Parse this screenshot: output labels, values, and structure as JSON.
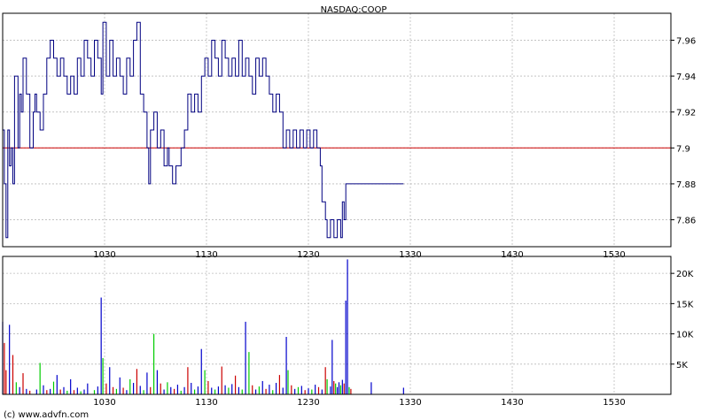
{
  "chart_data": [
    {
      "type": "line",
      "title": "NASDAQ:COOP",
      "xlabel": "",
      "ylabel": "",
      "x_ticks": [
        "1030",
        "1130",
        "1230",
        "1330",
        "1430",
        "1530"
      ],
      "y_ticks": [
        "7.86",
        "7.88",
        "7.9",
        "7.92",
        "7.94",
        "7.96"
      ],
      "ylim": [
        7.845,
        7.975
      ],
      "xlim_minutes": [
        570,
        960
      ],
      "reference_line": {
        "value": 7.9,
        "color": "#cc0000"
      },
      "series": [
        {
          "color": "#000080",
          "points": [
            [
              570,
              7.91
            ],
            [
              571,
              7.88
            ],
            [
              572,
              7.85
            ],
            [
              573,
              7.91
            ],
            [
              574,
              7.89
            ],
            [
              575,
              7.9
            ],
            [
              576,
              7.88
            ],
            [
              577,
              7.94
            ],
            [
              579,
              7.9
            ],
            [
              580,
              7.93
            ],
            [
              581,
              7.92
            ],
            [
              582,
              7.95
            ],
            [
              584,
              7.93
            ],
            [
              586,
              7.9
            ],
            [
              588,
              7.92
            ],
            [
              589,
              7.93
            ],
            [
              590,
              7.92
            ],
            [
              592,
              7.91
            ],
            [
              594,
              7.93
            ],
            [
              596,
              7.95
            ],
            [
              598,
              7.96
            ],
            [
              600,
              7.95
            ],
            [
              602,
              7.94
            ],
            [
              604,
              7.95
            ],
            [
              606,
              7.94
            ],
            [
              608,
              7.93
            ],
            [
              610,
              7.94
            ],
            [
              612,
              7.93
            ],
            [
              614,
              7.95
            ],
            [
              616,
              7.94
            ],
            [
              618,
              7.96
            ],
            [
              620,
              7.95
            ],
            [
              622,
              7.94
            ],
            [
              624,
              7.96
            ],
            [
              626,
              7.95
            ],
            [
              628,
              7.93
            ],
            [
              629,
              7.97
            ],
            [
              631,
              7.94
            ],
            [
              633,
              7.96
            ],
            [
              635,
              7.94
            ],
            [
              637,
              7.95
            ],
            [
              639,
              7.94
            ],
            [
              641,
              7.93
            ],
            [
              643,
              7.95
            ],
            [
              645,
              7.94
            ],
            [
              647,
              7.96
            ],
            [
              649,
              7.97
            ],
            [
              651,
              7.93
            ],
            [
              653,
              7.92
            ],
            [
              655,
              7.9
            ],
            [
              656,
              7.88
            ],
            [
              657,
              7.91
            ],
            [
              659,
              7.92
            ],
            [
              661,
              7.9
            ],
            [
              663,
              7.91
            ],
            [
              665,
              7.89
            ],
            [
              667,
              7.9
            ],
            [
              668,
              7.89
            ],
            [
              670,
              7.88
            ],
            [
              672,
              7.89
            ],
            [
              674,
              7.89
            ],
            [
              675,
              7.9
            ],
            [
              677,
              7.91
            ],
            [
              679,
              7.93
            ],
            [
              681,
              7.92
            ],
            [
              683,
              7.93
            ],
            [
              685,
              7.92
            ],
            [
              687,
              7.94
            ],
            [
              689,
              7.95
            ],
            [
              691,
              7.94
            ],
            [
              693,
              7.96
            ],
            [
              695,
              7.95
            ],
            [
              697,
              7.94
            ],
            [
              699,
              7.96
            ],
            [
              701,
              7.95
            ],
            [
              703,
              7.94
            ],
            [
              705,
              7.95
            ],
            [
              707,
              7.94
            ],
            [
              709,
              7.96
            ],
            [
              711,
              7.94
            ],
            [
              713,
              7.95
            ],
            [
              715,
              7.94
            ],
            [
              717,
              7.93
            ],
            [
              719,
              7.95
            ],
            [
              721,
              7.94
            ],
            [
              723,
              7.95
            ],
            [
              725,
              7.94
            ],
            [
              727,
              7.93
            ],
            [
              729,
              7.92
            ],
            [
              731,
              7.93
            ],
            [
              733,
              7.92
            ],
            [
              735,
              7.9
            ],
            [
              737,
              7.91
            ],
            [
              739,
              7.9
            ],
            [
              741,
              7.91
            ],
            [
              743,
              7.9
            ],
            [
              745,
              7.91
            ],
            [
              747,
              7.9
            ],
            [
              749,
              7.91
            ],
            [
              751,
              7.9
            ],
            [
              753,
              7.91
            ],
            [
              755,
              7.9
            ],
            [
              757,
              7.89
            ],
            [
              758,
              7.87
            ],
            [
              760,
              7.86
            ],
            [
              761,
              7.85
            ],
            [
              763,
              7.86
            ],
            [
              765,
              7.85
            ],
            [
              767,
              7.86
            ],
            [
              769,
              7.85
            ],
            [
              770,
              7.87
            ],
            [
              771,
              7.86
            ],
            [
              772,
              7.88
            ],
            [
              776,
              7.88
            ],
            [
              780,
              7.88
            ],
            [
              786,
              7.88
            ],
            [
              792,
              7.88
            ],
            [
              800,
              7.88
            ],
            [
              806,
              7.88
            ]
          ]
        }
      ]
    },
    {
      "type": "bar",
      "title": "",
      "xlabel": "",
      "ylabel": "",
      "x_ticks": [
        "1030",
        "1130",
        "1230",
        "1330",
        "1430",
        "1530"
      ],
      "y_ticks": [
        "5K",
        "10K",
        "15K",
        "20K"
      ],
      "ylim": [
        0,
        22800
      ],
      "xlim_minutes": [
        570,
        960
      ],
      "series": [
        {
          "name": "",
          "color": "#0000cc"
        },
        {
          "name": "",
          "color": "#00cc00"
        },
        {
          "name": "",
          "color": "#cc0000"
        }
      ],
      "bars": [
        [
          570,
          12000,
          "#0000cc"
        ],
        [
          571,
          8500,
          "#cc0000"
        ],
        [
          572,
          4000,
          "#cc0000"
        ],
        [
          574,
          11500,
          "#0000cc"
        ],
        [
          576,
          6500,
          "#cc0000"
        ],
        [
          578,
          2000,
          "#00cc00"
        ],
        [
          580,
          1200,
          "#0000cc"
        ],
        [
          582,
          3500,
          "#cc0000"
        ],
        [
          584,
          900,
          "#0000cc"
        ],
        [
          586,
          600,
          "#cc0000"
        ],
        [
          590,
          800,
          "#0000cc"
        ],
        [
          592,
          5200,
          "#00cc00"
        ],
        [
          594,
          1500,
          "#0000cc"
        ],
        [
          596,
          700,
          "#cc0000"
        ],
        [
          598,
          900,
          "#0000cc"
        ],
        [
          600,
          2100,
          "#00cc00"
        ],
        [
          602,
          3200,
          "#0000cc"
        ],
        [
          604,
          800,
          "#cc0000"
        ],
        [
          606,
          1200,
          "#0000cc"
        ],
        [
          608,
          600,
          "#00cc00"
        ],
        [
          610,
          2500,
          "#0000cc"
        ],
        [
          612,
          700,
          "#cc0000"
        ],
        [
          614,
          1100,
          "#0000cc"
        ],
        [
          616,
          500,
          "#00cc00"
        ],
        [
          618,
          800,
          "#0000cc"
        ],
        [
          620,
          1800,
          "#0000cc"
        ],
        [
          624,
          700,
          "#00cc00"
        ],
        [
          626,
          1300,
          "#0000cc"
        ],
        [
          628,
          16000,
          "#0000cc"
        ],
        [
          629,
          6000,
          "#00cc00"
        ],
        [
          631,
          1800,
          "#cc0000"
        ],
        [
          633,
          4500,
          "#0000cc"
        ],
        [
          635,
          1200,
          "#cc0000"
        ],
        [
          637,
          900,
          "#00cc00"
        ],
        [
          639,
          2800,
          "#0000cc"
        ],
        [
          641,
          1100,
          "#cc0000"
        ],
        [
          643,
          700,
          "#0000cc"
        ],
        [
          645,
          2500,
          "#00cc00"
        ],
        [
          647,
          1900,
          "#0000cc"
        ],
        [
          649,
          4200,
          "#cc0000"
        ],
        [
          651,
          1400,
          "#0000cc"
        ],
        [
          653,
          700,
          "#00cc00"
        ],
        [
          655,
          3600,
          "#0000cc"
        ],
        [
          657,
          1200,
          "#cc0000"
        ],
        [
          659,
          10000,
          "#00cc00"
        ],
        [
          661,
          4000,
          "#0000cc"
        ],
        [
          663,
          1800,
          "#cc0000"
        ],
        [
          665,
          800,
          "#0000cc"
        ],
        [
          667,
          2000,
          "#00cc00"
        ],
        [
          669,
          1200,
          "#0000cc"
        ],
        [
          671,
          900,
          "#cc0000"
        ],
        [
          673,
          1600,
          "#0000cc"
        ],
        [
          675,
          600,
          "#00cc00"
        ],
        [
          677,
          1200,
          "#0000cc"
        ],
        [
          679,
          4500,
          "#cc0000"
        ],
        [
          681,
          1900,
          "#0000cc"
        ],
        [
          683,
          800,
          "#00cc00"
        ],
        [
          685,
          1300,
          "#0000cc"
        ],
        [
          687,
          7500,
          "#0000cc"
        ],
        [
          689,
          4000,
          "#00cc00"
        ],
        [
          691,
          2200,
          "#cc0000"
        ],
        [
          693,
          1100,
          "#0000cc"
        ],
        [
          695,
          800,
          "#00cc00"
        ],
        [
          697,
          1300,
          "#0000cc"
        ],
        [
          699,
          4600,
          "#cc0000"
        ],
        [
          701,
          1500,
          "#0000cc"
        ],
        [
          703,
          1100,
          "#00cc00"
        ],
        [
          705,
          1700,
          "#0000cc"
        ],
        [
          707,
          3100,
          "#cc0000"
        ],
        [
          709,
          1200,
          "#0000cc"
        ],
        [
          711,
          800,
          "#00cc00"
        ],
        [
          713,
          12000,
          "#0000cc"
        ],
        [
          715,
          7000,
          "#00cc00"
        ],
        [
          717,
          1500,
          "#cc0000"
        ],
        [
          719,
          800,
          "#0000cc"
        ],
        [
          721,
          1300,
          "#00cc00"
        ],
        [
          723,
          2200,
          "#0000cc"
        ],
        [
          725,
          900,
          "#cc0000"
        ],
        [
          727,
          1600,
          "#0000cc"
        ],
        [
          729,
          700,
          "#00cc00"
        ],
        [
          731,
          1900,
          "#0000cc"
        ],
        [
          733,
          3200,
          "#cc0000"
        ],
        [
          735,
          1100,
          "#0000cc"
        ],
        [
          737,
          9500,
          "#0000cc"
        ],
        [
          738,
          4000,
          "#00cc00"
        ],
        [
          740,
          1500,
          "#cc0000"
        ],
        [
          742,
          900,
          "#0000cc"
        ],
        [
          744,
          1200,
          "#00cc00"
        ],
        [
          746,
          1400,
          "#0000cc"
        ],
        [
          748,
          700,
          "#cc0000"
        ],
        [
          750,
          1000,
          "#0000cc"
        ],
        [
          752,
          800,
          "#00cc00"
        ],
        [
          754,
          1600,
          "#0000cc"
        ],
        [
          756,
          1200,
          "#cc0000"
        ],
        [
          758,
          800,
          "#0000cc"
        ],
        [
          760,
          4500,
          "#cc0000"
        ],
        [
          761,
          2500,
          "#00cc00"
        ],
        [
          763,
          1300,
          "#0000cc"
        ],
        [
          764,
          9000,
          "#0000cc"
        ],
        [
          765,
          2200,
          "#cc0000"
        ],
        [
          766,
          1800,
          "#00cc00"
        ],
        [
          767,
          1200,
          "#0000cc"
        ],
        [
          768,
          2000,
          "#0000cc"
        ],
        [
          769,
          1500,
          "#00cc00"
        ],
        [
          770,
          2400,
          "#0000cc"
        ],
        [
          771,
          1800,
          "#cc0000"
        ],
        [
          772,
          15500,
          "#0000cc"
        ],
        [
          773,
          22300,
          "#0000cc"
        ],
        [
          774,
          1200,
          "#00cc00"
        ],
        [
          775,
          900,
          "#cc0000"
        ],
        [
          787,
          2000,
          "#0000cc"
        ],
        [
          806,
          1100,
          "#0000cc"
        ]
      ]
    }
  ],
  "footer": {
    "copyright": "(c) www.advfn.com"
  }
}
